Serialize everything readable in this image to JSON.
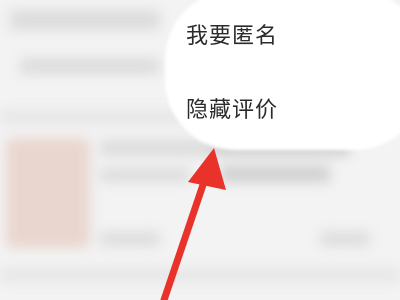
{
  "menu": {
    "items": [
      {
        "label": "我要匿名"
      },
      {
        "label": "隐藏评价"
      }
    ]
  },
  "colors": {
    "arrow": "#e8322a",
    "menu_bg": "#ffffff",
    "page_bg": "#f3f3f3"
  }
}
